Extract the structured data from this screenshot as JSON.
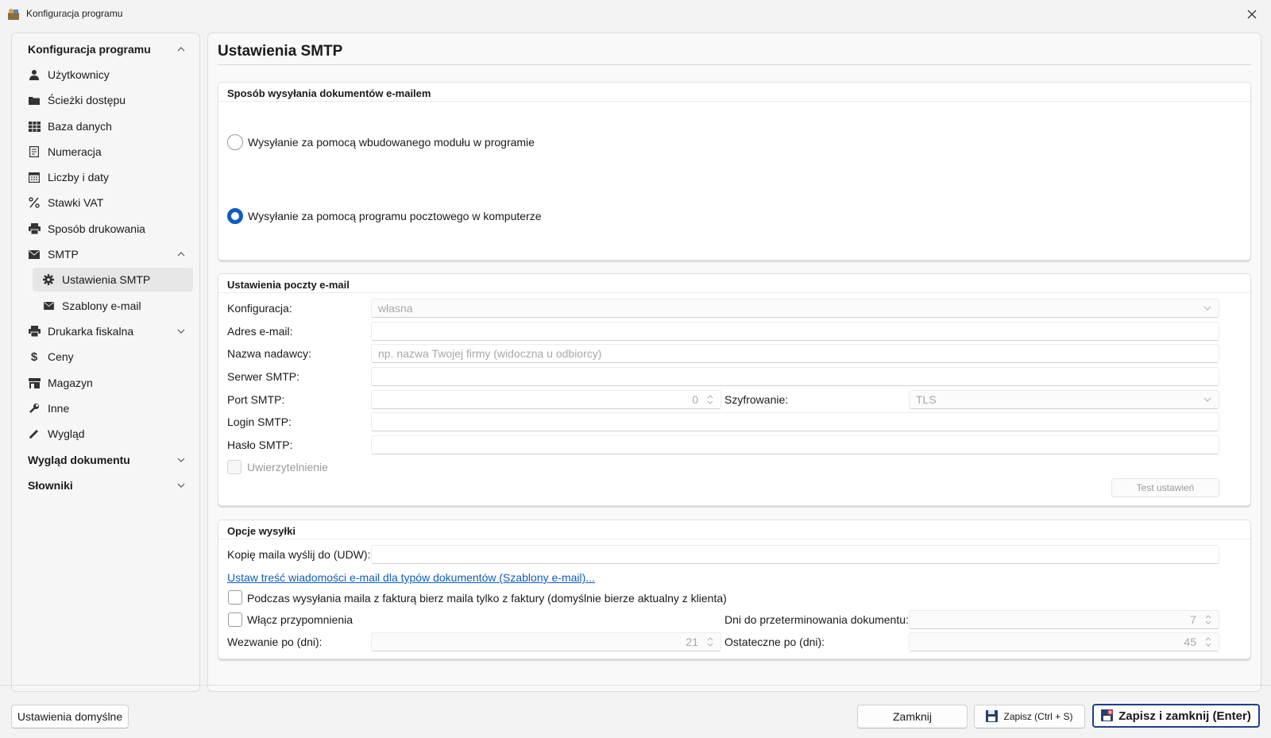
{
  "window": {
    "title": "Konfiguracja programu"
  },
  "sidebar": {
    "groups": [
      {
        "label": "Konfiguracja programu"
      },
      {
        "label": "Wygląd dokumentu"
      },
      {
        "label": "Słowniki"
      }
    ],
    "items": [
      {
        "label": "Użytkownicy",
        "icon": "user-icon"
      },
      {
        "label": "Ścieżki dostępu",
        "icon": "folder-icon"
      },
      {
        "label": "Baza danych",
        "icon": "table-icon"
      },
      {
        "label": "Numeracja",
        "icon": "document-icon"
      },
      {
        "label": "Liczby i daty",
        "icon": "calendar-icon"
      },
      {
        "label": "Stawki VAT",
        "icon": "percent-icon"
      },
      {
        "label": "Sposób drukowania",
        "icon": "printer-icon"
      },
      {
        "label": "SMTP",
        "icon": "envelope-icon"
      },
      {
        "label": "Ustawienia SMTP",
        "icon": "gear-icon"
      },
      {
        "label": "Szablony e-mail",
        "icon": "envelope-icon"
      },
      {
        "label": "Drukarka fiskalna",
        "icon": "printer-icon"
      },
      {
        "label": "Ceny",
        "icon": "dollar-icon"
      },
      {
        "label": "Magazyn",
        "icon": "store-icon"
      },
      {
        "label": "Inne",
        "icon": "wrench-icon"
      },
      {
        "label": "Wygląd",
        "icon": "pencil-icon"
      }
    ]
  },
  "main": {
    "title": "Ustawienia SMTP",
    "sending_method": {
      "title": "Sposób wysyłania dokumentów e-mailem",
      "options": [
        {
          "label": "Wysyłanie za pomocą wbudowanego modułu w programie",
          "checked": false
        },
        {
          "label": "Wysyłanie za pomocą programu pocztowego w komputerze",
          "checked": true
        }
      ]
    },
    "mail_settings": {
      "title": "Ustawienia poczty e-mail",
      "config_label": "Konfiguracja:",
      "config_value": "własna",
      "email_label": "Adres e-mail:",
      "email_value": "",
      "sender_label": "Nazwa nadawcy:",
      "sender_placeholder": "np. nazwa Twojej firmy (widoczna u odbiorcy)",
      "server_label": "Serwer SMTP:",
      "server_value": "",
      "port_label": "Port SMTP:",
      "port_value": "0",
      "encryption_label": "Szyfrowanie:",
      "encryption_value": "TLS",
      "login_label": "Login SMTP:",
      "login_value": "",
      "password_label": "Hasło SMTP:",
      "password_value": "",
      "auth_label": "Uwierzytelnienie",
      "test_button": "Test ustawień"
    },
    "send_options": {
      "title": "Opcje wysyłki",
      "bcc_label": "Kopię maila wyślij do (UDW):",
      "bcc_value": "",
      "templates_link": "Ustaw treść wiadomości e-mail dla typów dokumentów (Szablony e-mail)...",
      "invoice_mail_label": "Podczas wysyłania maila z fakturą bierz maila tylko z faktury (domyślnie bierze aktualny z klienta)",
      "reminders_label": "Włącz przypomnienia",
      "overdue_label": "Dni do przeterminowania dokumentu:",
      "overdue_value": "7",
      "summons_label": "Wezwanie po (dni):",
      "summons_value": "21",
      "final_label": "Ostateczne po (dni):",
      "final_value": "45"
    }
  },
  "footer": {
    "defaults_button": "Ustawienia domyślne",
    "close_button": "Zamknij",
    "save_button": "Zapisz (Ctrl + S)",
    "save_close_button": "Zapisz i zamknij (Enter)"
  },
  "colors": {
    "accent": "#0f5dbd",
    "primary_border": "#1f3f8f"
  }
}
